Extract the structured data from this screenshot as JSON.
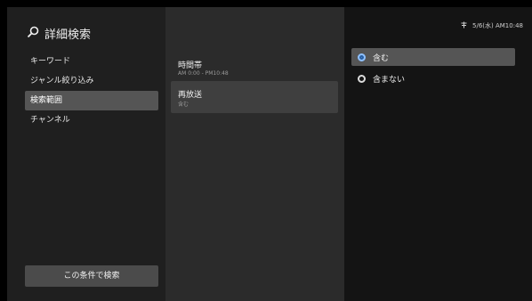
{
  "header": {
    "title": "詳細検索",
    "status_icon": "signal-icon",
    "datetime": "5/6(水) AM10:48"
  },
  "left_menu": {
    "items": [
      {
        "label": "キーワード"
      },
      {
        "label": "ジャンル絞り込み"
      },
      {
        "label": "検索範囲"
      },
      {
        "label": "チャンネル"
      }
    ],
    "selected_index": 2,
    "search_button": "この条件で検索"
  },
  "middle": {
    "items": [
      {
        "label": "時間帯",
        "value": "AM 0:00 - PM10:48"
      },
      {
        "label": "再放送",
        "value": "含む"
      }
    ],
    "selected_index": 1
  },
  "options": {
    "items": [
      {
        "label": "含む"
      },
      {
        "label": "含まない"
      }
    ],
    "selected_index": 0
  },
  "colors": {
    "accent": "#3f8ff0"
  }
}
